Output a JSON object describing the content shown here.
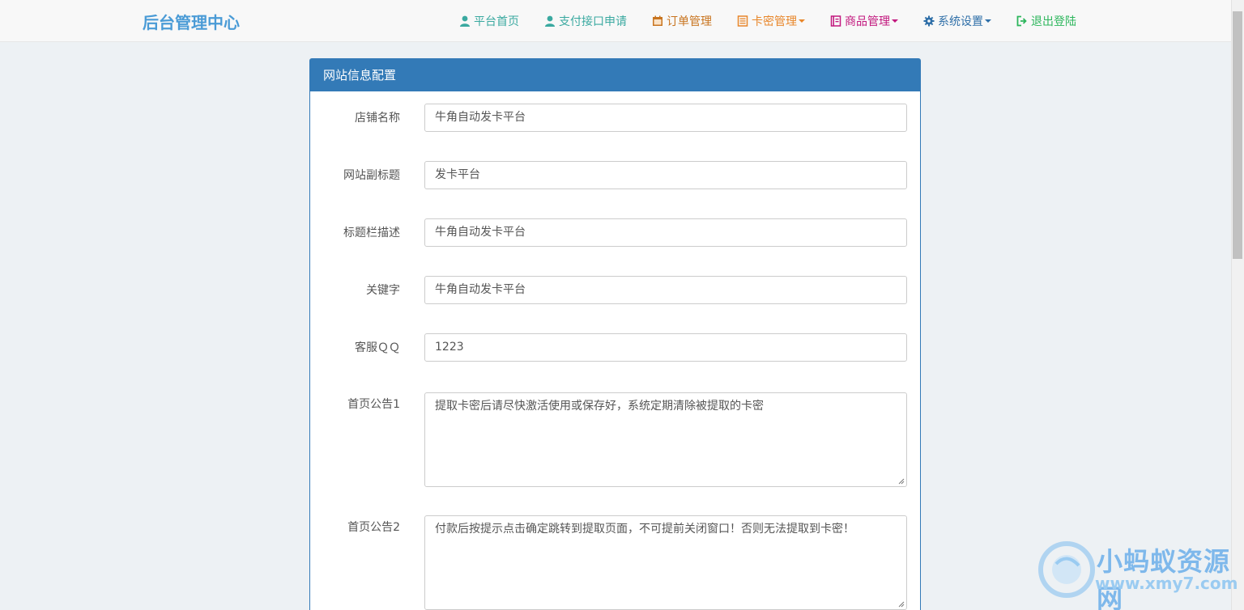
{
  "navbar": {
    "brand": "后台管理中心",
    "items": [
      {
        "label": "平台首页",
        "icon": "user-icon",
        "color": "#3aa9a0",
        "dropdown": false
      },
      {
        "label": "支付接口申请",
        "icon": "user-icon",
        "color": "#3aa9a0",
        "dropdown": false
      },
      {
        "label": "订单管理",
        "icon": "calendar-icon",
        "color": "#c8741f",
        "dropdown": false
      },
      {
        "label": "卡密管理",
        "icon": "list-icon",
        "color": "#e8862a",
        "dropdown": true
      },
      {
        "label": "商品管理",
        "icon": "book-icon",
        "color": "#c2187e",
        "dropdown": true
      },
      {
        "label": "系统设置",
        "icon": "gear-icon",
        "color": "#2f6fa8",
        "dropdown": true
      },
      {
        "label": "退出登陆",
        "icon": "logout-icon",
        "color": "#2db65c",
        "dropdown": false
      }
    ]
  },
  "panel": {
    "title": "网站信息配置",
    "fields": [
      {
        "label": "店铺名称",
        "value": "牛角自动发卡平台"
      },
      {
        "label": "网站副标题",
        "value": "发卡平台"
      },
      {
        "label": "标题栏描述",
        "value": "牛角自动发卡平台"
      },
      {
        "label": "关键字",
        "value": "牛角自动发卡平台"
      },
      {
        "label": "客服ＱＱ",
        "value": "1223"
      }
    ],
    "notices": [
      {
        "label": "首页公告1",
        "value": "提取卡密后请尽快激活使用或保存好，系统定期清除被提取的卡密"
      },
      {
        "label": "首页公告2",
        "value": "付款后按提示点击确定跳转到提取页面，不可提前关闭窗口！否则无法提取到卡密！"
      }
    ]
  },
  "watermark": {
    "line1": "小蚂蚁资源网",
    "line2": "www.xmy7.com"
  },
  "colors": {
    "accent": "#337ab7",
    "brand": "#4a9bd6",
    "background": "#edf1f4"
  }
}
